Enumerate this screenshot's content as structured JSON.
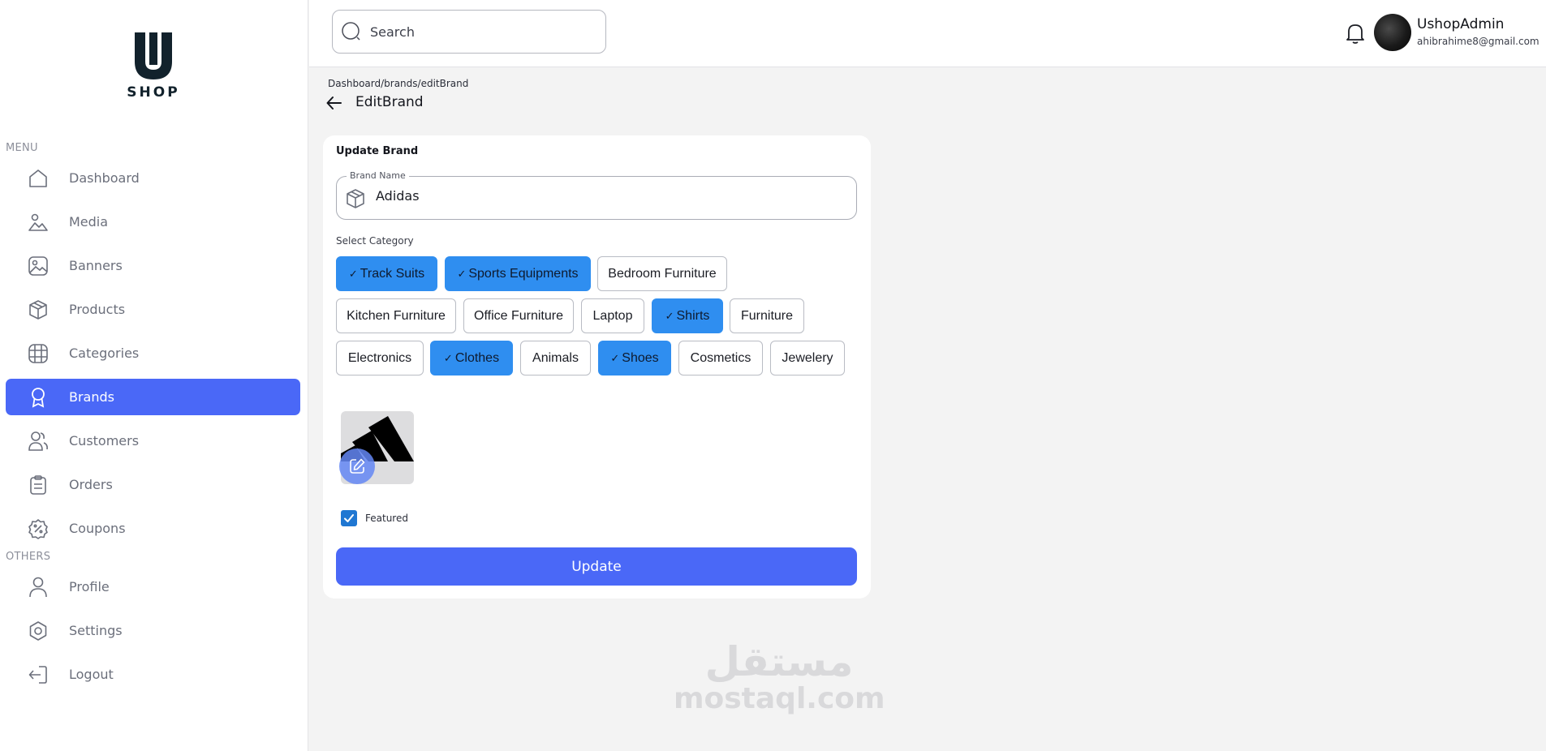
{
  "brand": {
    "logo_letter": "U",
    "logo_text": "SHOP"
  },
  "sidebar": {
    "menu_label": "MENU",
    "others_label": "OTHERS",
    "items": [
      {
        "label": "Dashboard",
        "icon": "home-icon"
      },
      {
        "label": "Media",
        "icon": "media-icon"
      },
      {
        "label": "Banners",
        "icon": "image-icon"
      },
      {
        "label": "Products",
        "icon": "box-icon"
      },
      {
        "label": "Categories",
        "icon": "globe-icon"
      },
      {
        "label": "Brands",
        "icon": "award-icon",
        "active": true
      },
      {
        "label": "Customers",
        "icon": "users-icon"
      },
      {
        "label": "Orders",
        "icon": "clipboard-icon"
      },
      {
        "label": "Coupons",
        "icon": "discount-icon"
      }
    ],
    "others": [
      {
        "label": "Profile",
        "icon": "user-icon"
      },
      {
        "label": "Settings",
        "icon": "gear-icon"
      },
      {
        "label": "Logout",
        "icon": "logout-icon"
      }
    ]
  },
  "topbar": {
    "search_placeholder": "Search",
    "user_name": "UshopAdmin",
    "user_email": "ahibrahime8@gmail.com"
  },
  "page": {
    "breadcrumb": "Dashboard/brands/editBrand",
    "title": "EditBrand"
  },
  "form": {
    "card_title": "Update Brand",
    "brand_name_label": "Brand Name",
    "brand_name_value": "Adidas",
    "category_label": "Select Category",
    "categories": [
      {
        "label": "Track Suits",
        "selected": true
      },
      {
        "label": "Sports Equipments",
        "selected": true
      },
      {
        "label": "Bedroom Furniture",
        "selected": false
      },
      {
        "label": "Kitchen Furniture",
        "selected": false
      },
      {
        "label": "Office Furniture",
        "selected": false
      },
      {
        "label": "Laptop",
        "selected": false
      },
      {
        "label": "Shirts",
        "selected": true
      },
      {
        "label": "Furniture",
        "selected": false
      },
      {
        "label": "Electronics",
        "selected": false
      },
      {
        "label": "Clothes",
        "selected": true
      },
      {
        "label": "Animals",
        "selected": false
      },
      {
        "label": "Shoes",
        "selected": true
      },
      {
        "label": "Cosmetics",
        "selected": false
      },
      {
        "label": "Jewelery",
        "selected": false
      }
    ],
    "featured_label": "Featured",
    "featured_checked": true,
    "update_label": "Update"
  },
  "watermark": {
    "arabic": "مستقل",
    "latin": "mostaql.com"
  },
  "colors": {
    "accent": "#4a68f7",
    "chip_selected": "#2f8ef0",
    "checkbox": "#1f77d2"
  }
}
